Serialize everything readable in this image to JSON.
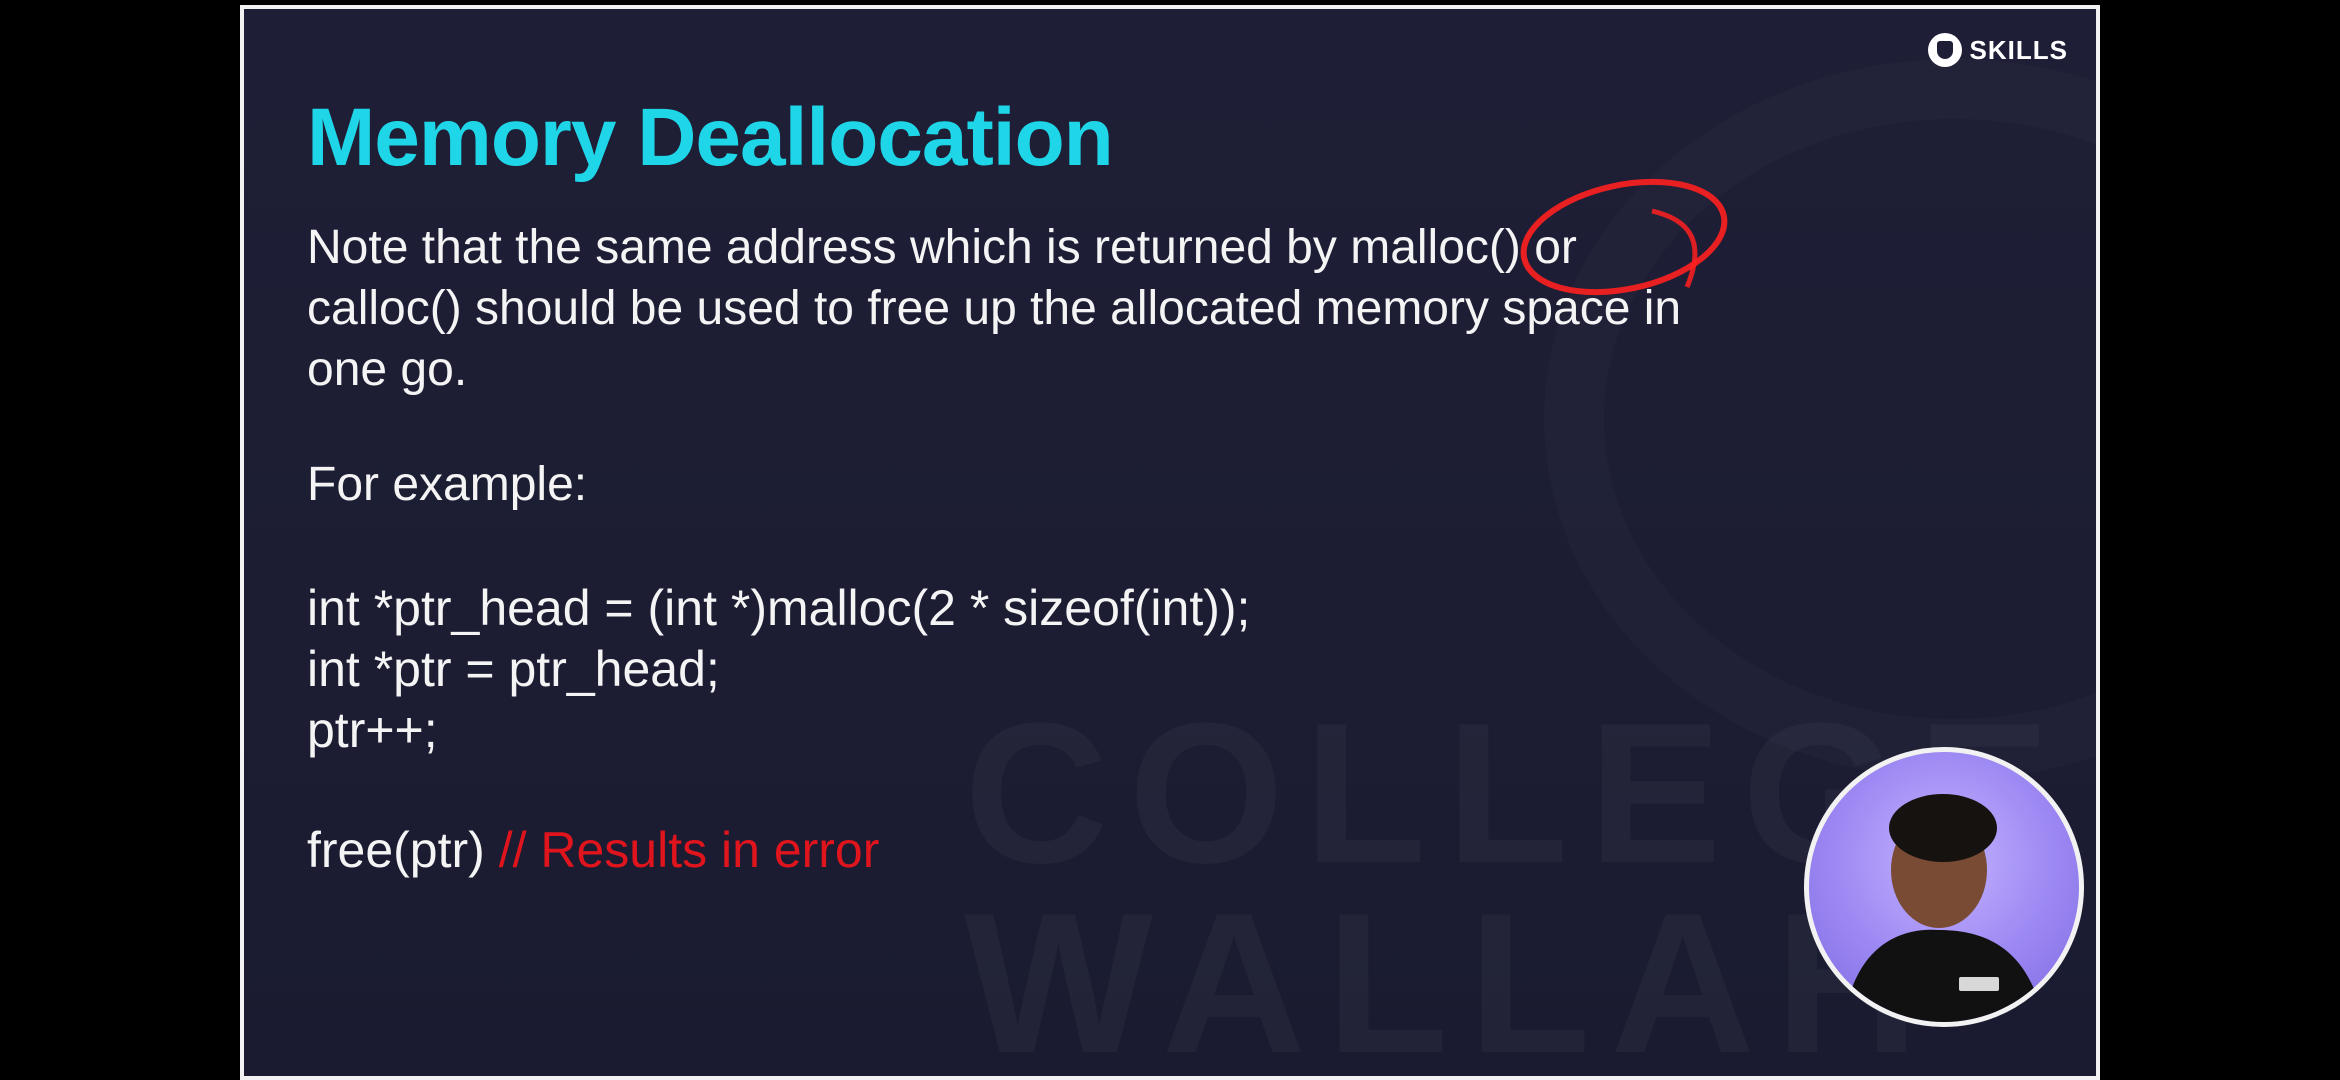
{
  "brand": {
    "name": "SKILLS",
    "logo_icon": "skills-logo-icon"
  },
  "slide": {
    "title": "Memory Deallocation",
    "paragraph_line1": "Note that the same address which is returned by malloc() or",
    "paragraph_line2": "calloc() should be used to free up the allocated memory space in",
    "paragraph_line3": "one go.",
    "example_label": "For example:",
    "code_lines": [
      "int *ptr_head = (int *)malloc(2 * sizeof(int));",
      "int *ptr = ptr_head;",
      "ptr++;"
    ],
    "free_call": "free(ptr)",
    "free_comment": "// Results in error",
    "watermark": "COLLEGE\nWALLAH"
  },
  "colors": {
    "title": "#1fd6e8",
    "body_text": "#f4f4f4",
    "comment": "#e0141c",
    "slide_background": "#1e1f36",
    "annotation": "#ff2020"
  },
  "webcam": {
    "icon": "presenter-video-feed"
  }
}
